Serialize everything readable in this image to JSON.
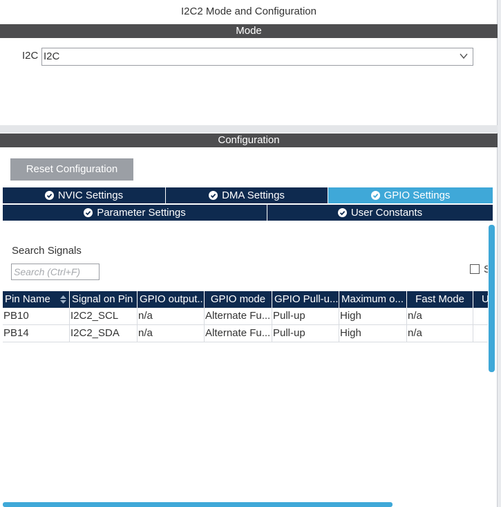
{
  "window": {
    "title": "I2C2 Mode and Configuration"
  },
  "mode": {
    "header": "Mode",
    "i2c_label": "I2C",
    "i2c_value": "I2C"
  },
  "configuration": {
    "header": "Configuration",
    "reset_label": "Reset Configuration",
    "tabs_row1": [
      {
        "label": "NVIC Settings",
        "active": false
      },
      {
        "label": "DMA Settings",
        "active": false
      },
      {
        "label": "GPIO Settings",
        "active": true
      }
    ],
    "tabs_row2": [
      {
        "label": "Parameter Settings",
        "active": false
      },
      {
        "label": "User Constants",
        "active": false
      }
    ]
  },
  "search": {
    "label": "Search Signals",
    "placeholder": "Search (Ctrl+F)",
    "show_label": "S"
  },
  "table": {
    "columns": [
      "Pin Name",
      "Signal on Pin",
      "GPIO output...",
      "GPIO mode",
      "GPIO Pull-u...",
      "Maximum o...",
      "Fast Mode",
      "U"
    ],
    "rows": [
      [
        "PB10",
        "I2C2_SCL",
        "n/a",
        "Alternate Fu...",
        "Pull-up",
        "High",
        "n/a",
        ""
      ],
      [
        "PB14",
        "I2C2_SDA",
        "n/a",
        "Alternate Fu...",
        "Pull-up",
        "High",
        "n/a",
        ""
      ]
    ]
  },
  "colors": {
    "header_bar": "#4d4d4f",
    "tab_dark": "#0e2a4f",
    "tab_active": "#3fa8d8",
    "button_grey": "#9b9fa5",
    "scrollbar": "#3fa8d8"
  }
}
